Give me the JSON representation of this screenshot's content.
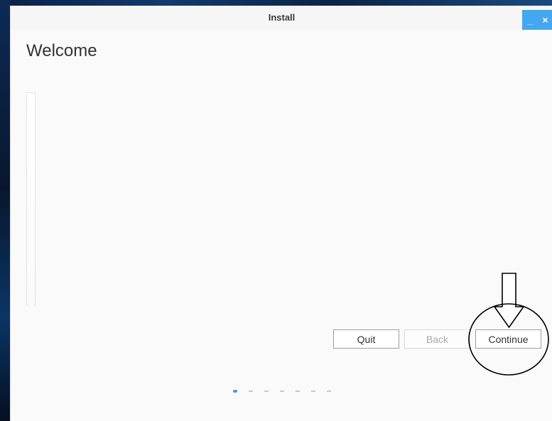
{
  "window": {
    "title": "Install",
    "minimize_glyph": "_",
    "close_glyph": "×"
  },
  "page": {
    "heading": "Welcome"
  },
  "buttons": {
    "quit_label": "Quit",
    "back_label": "Back",
    "continue_label": "Continue"
  },
  "progress": {
    "steps": 7,
    "current_step": 1
  },
  "colors": {
    "accent": "#3d9ce8",
    "titlebar_button": "#44a7ef",
    "window_background": "#fafafa"
  },
  "annotation": {
    "description": "hand-drawn down arrow and circle highlighting the Continue button",
    "icons": [
      "down-arrow-annotation-icon",
      "highlight-circle-annotation"
    ]
  }
}
